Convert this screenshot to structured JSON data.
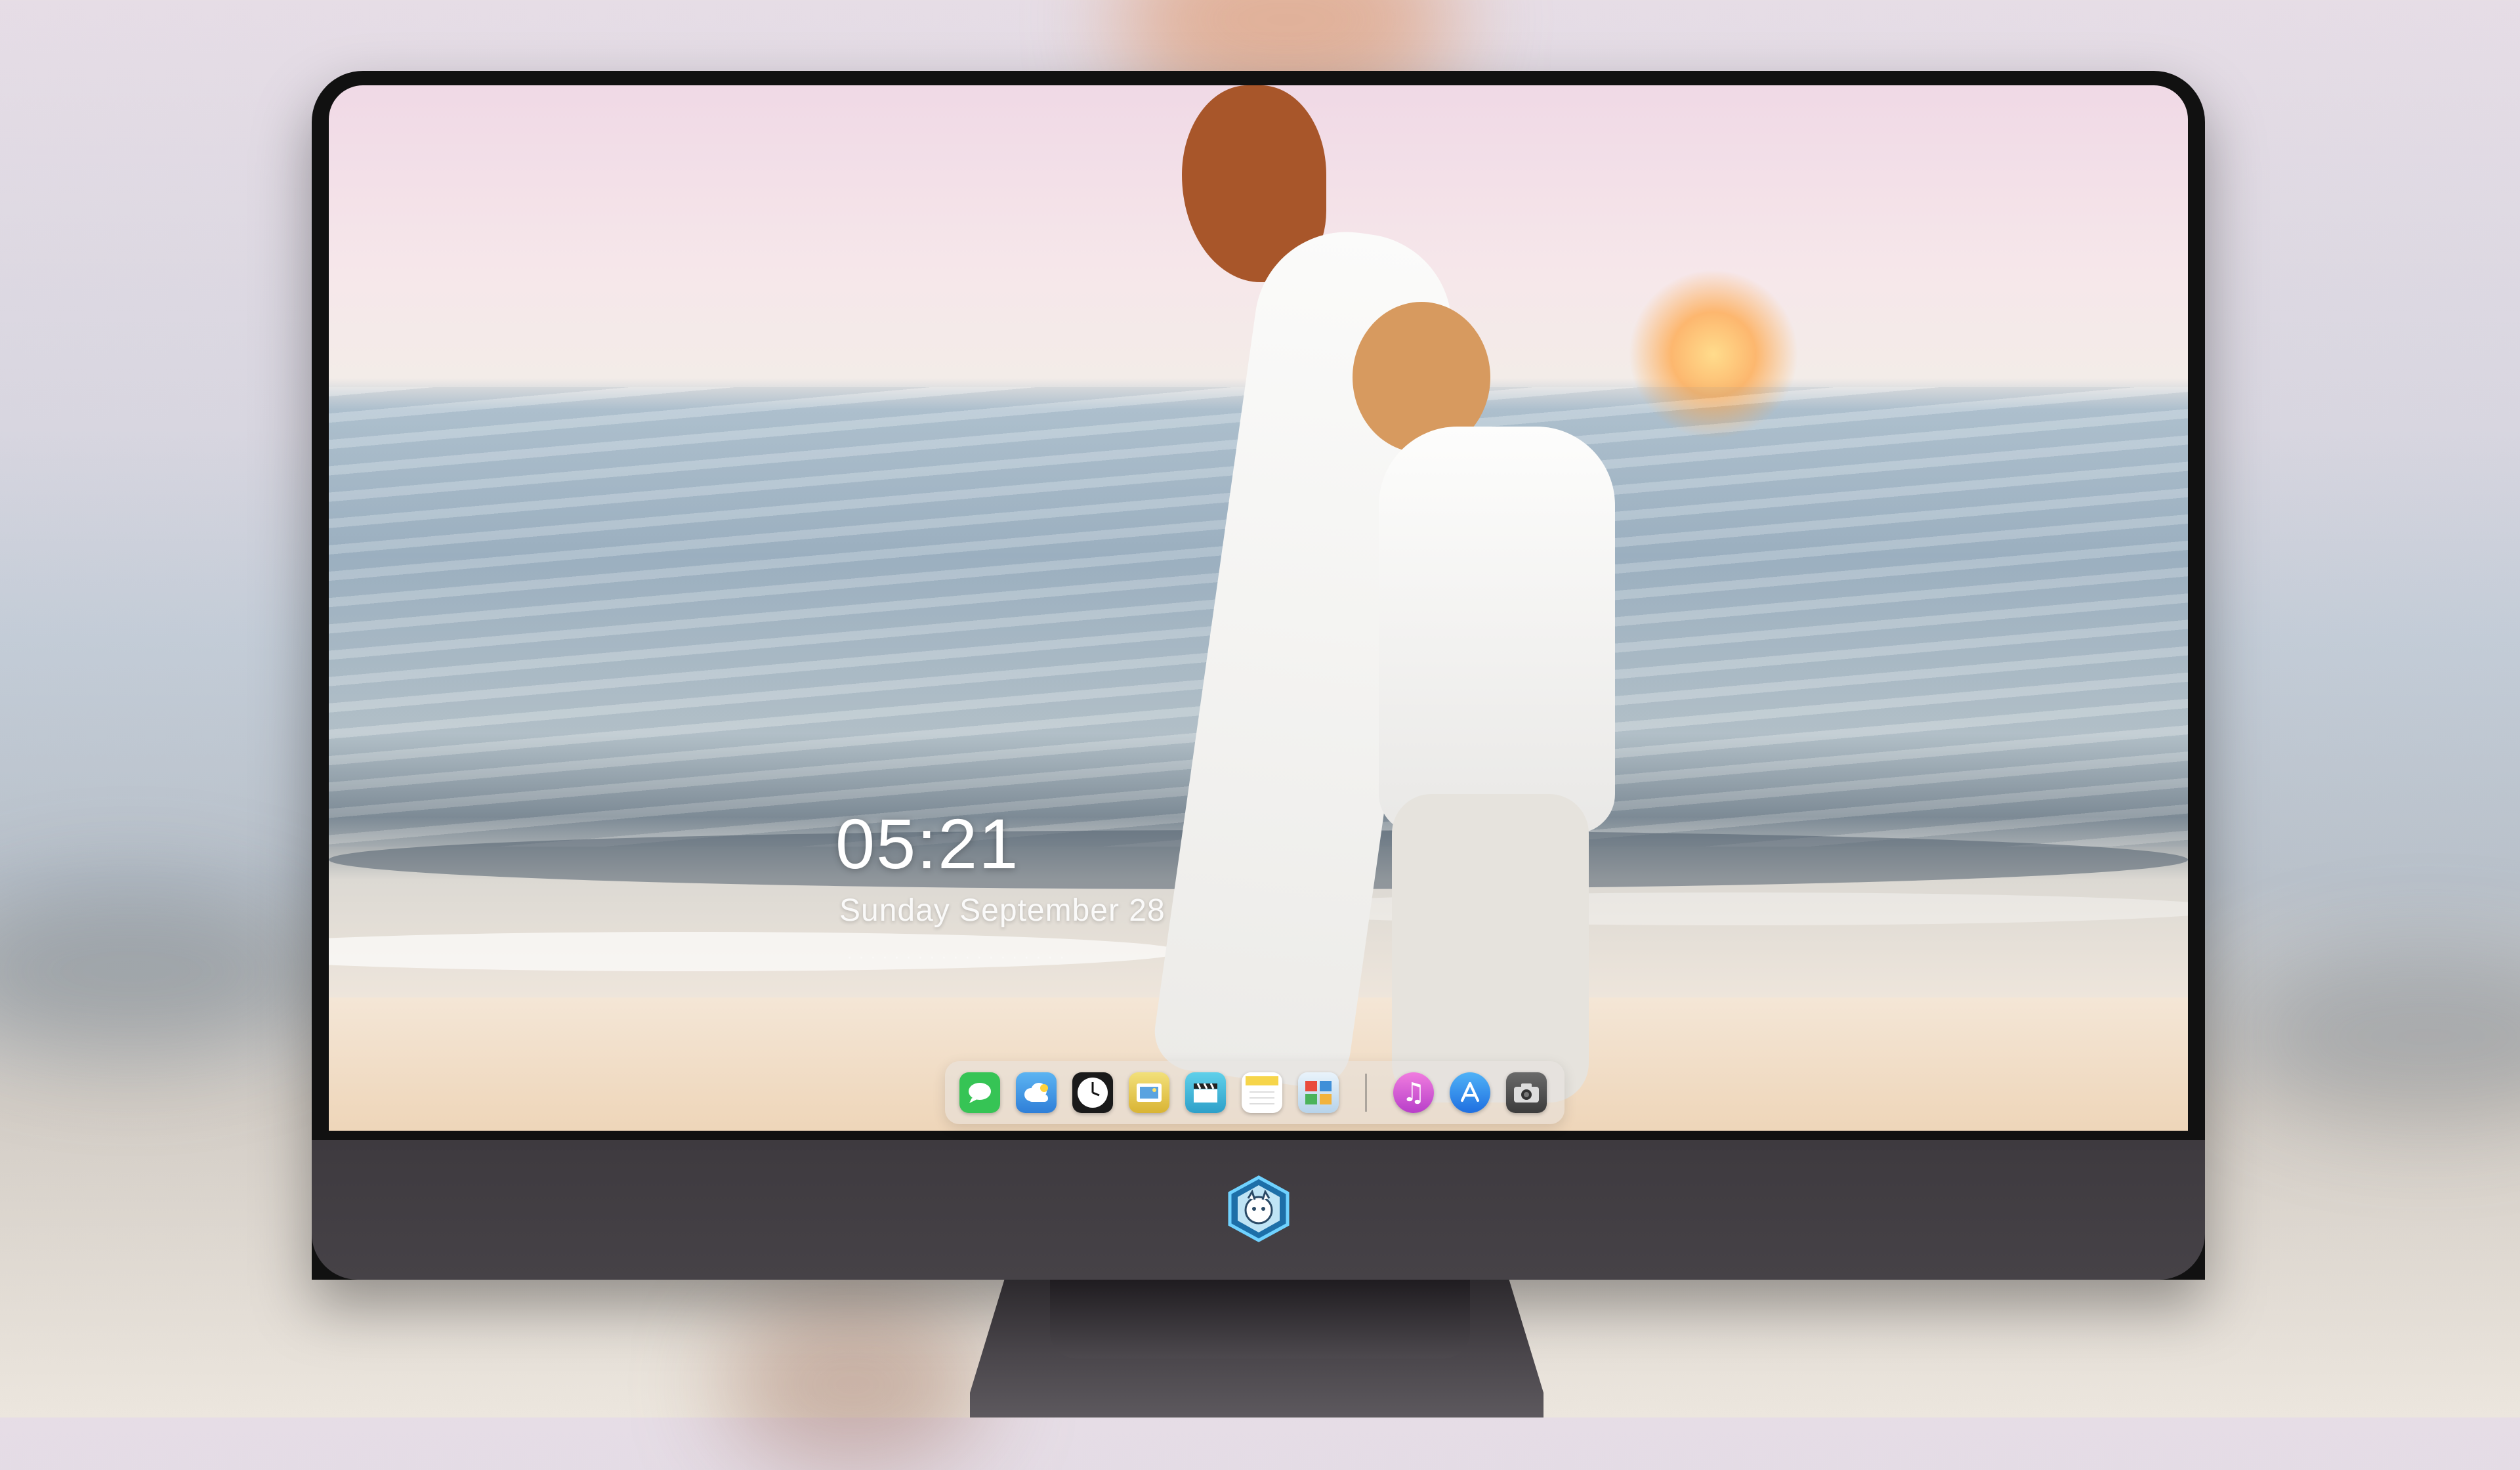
{
  "lockscreen": {
    "time": "05:21",
    "date": "Sunday September  28",
    "hint": "· · · · · · · · · · · · · · · · · · ·"
  },
  "dock": {
    "apps": [
      {
        "name": "Messages",
        "icon": "message-bubble-icon",
        "color": "#36c455"
      },
      {
        "name": "Weather",
        "icon": "cloud-icon",
        "color": "#2f8fe0"
      },
      {
        "name": "Clock",
        "icon": "clock-icon",
        "color": "#1a1a1a"
      },
      {
        "name": "Preview",
        "icon": "picture-frame-icon",
        "color": "#e0c040"
      },
      {
        "name": "Video",
        "icon": "clapperboard-icon",
        "color": "#39b7d9"
      },
      {
        "name": "Notes",
        "icon": "notepad-icon",
        "color": "#f6d54a"
      },
      {
        "name": "Photo Booth",
        "icon": "photo-stack-icon",
        "color": "#6aa7d8"
      },
      {
        "name": "Music",
        "icon": "music-note-icon",
        "color": "#e44cc9"
      },
      {
        "name": "App Store",
        "icon": "app-store-icon",
        "color": "#2e8ef0"
      },
      {
        "name": "Camera",
        "icon": "camera-icon",
        "color": "#555555"
      }
    ]
  },
  "colors": {
    "bezel": "#111111",
    "chin": "#433f44",
    "dock_bg": "#e6e2de"
  }
}
